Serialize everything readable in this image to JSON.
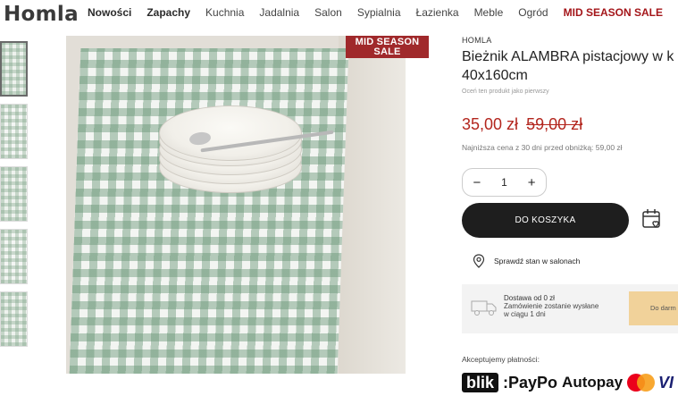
{
  "header": {
    "logo": "Homla",
    "nav": [
      "Nowości",
      "Zapachy",
      "Kuchnia",
      "Jadalnia",
      "Salon",
      "Sypialnia",
      "Łazienka",
      "Meble",
      "Ogród"
    ],
    "sale": "MID SEASON SALE"
  },
  "gallery": {
    "badge_line1": "MID SEASON",
    "badge_line2": "SALE"
  },
  "product": {
    "brand": "HOMLA",
    "title_line1": "Bieżnik ALAMBRA pistacjowy w k",
    "title_line2": "40x160cm",
    "rate_prompt": "Oceń ten produkt jako pierwszy",
    "price_new": "35,00 zł",
    "price_old": "59,00 zł",
    "lowest_price": "Najniższa cena z 30 dni przed obniżką: 59,00 zł",
    "quantity": "1",
    "minus": "−",
    "plus": "+",
    "add_to_cart": "DO KOSZYKA",
    "check_stock": "Sprawdź stan w salonach"
  },
  "delivery": {
    "line1": "Dostawa od 0 zł",
    "line2": "Zamówienie zostanie wysłane",
    "line3": "w ciągu 1 dni",
    "gift": "Do darm"
  },
  "payments": {
    "label": "Akceptujemy płatności:",
    "blik": "blik",
    "paypo": ":PayPo",
    "autopay": "Autopay",
    "visa": "VI"
  },
  "colors": {
    "sale_red": "#a4161a",
    "price_red": "#b3261e",
    "cart_button": "#1e1e1e",
    "gift_box": "#f1d29a"
  },
  "icons": [
    "calendar-heart-icon",
    "location-pin-icon",
    "delivery-truck-icon",
    "mastercard-icon"
  ]
}
